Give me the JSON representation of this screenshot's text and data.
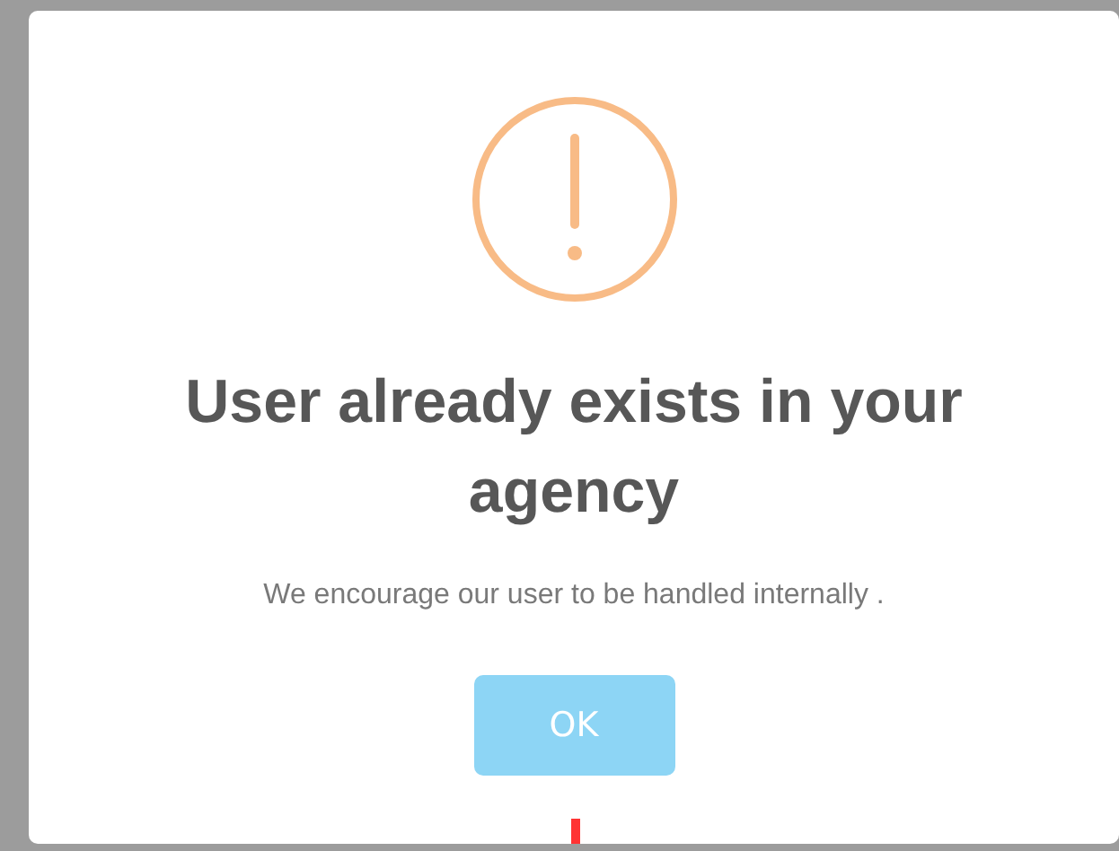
{
  "dialog": {
    "kind": "warning",
    "title": "User already exists in your agency",
    "message": "We encourage our user to be handled internally .",
    "buttons": [
      {
        "label": "OK",
        "disabled": true
      }
    ]
  }
}
